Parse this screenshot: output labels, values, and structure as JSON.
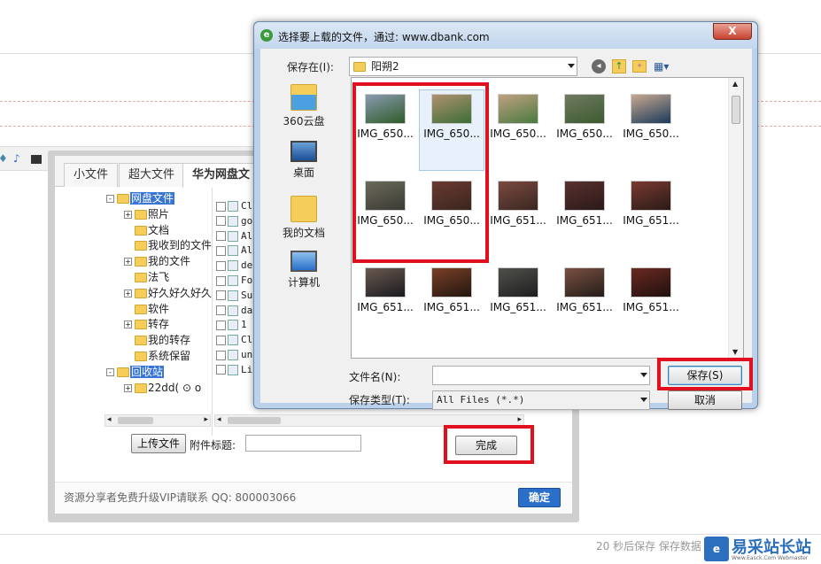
{
  "dialog": {
    "title": "选择要上载的文件，通过: www.dbank.com",
    "close_label": "X",
    "save_in_label": "保存在(I):",
    "save_in_value": "阳朔2",
    "places": [
      {
        "label": "360云盘",
        "icon": "cloud-folder-icon"
      },
      {
        "label": "桌面",
        "icon": "desktop-icon"
      },
      {
        "label": "我的文档",
        "icon": "documents-folder-icon"
      },
      {
        "label": "计算机",
        "icon": "computer-icon"
      }
    ],
    "files": [
      {
        "label": "IMG_650...",
        "c1": "#2e5b2a",
        "c2": "#8a9bb0"
      },
      {
        "label": "IMG_650...",
        "c1": "#3b6e35",
        "c2": "#b09070"
      },
      {
        "label": "IMG_650...",
        "c1": "#4a7a40",
        "c2": "#c0a080"
      },
      {
        "label": "IMG_650...",
        "c1": "#3c5a30",
        "c2": "#707a60"
      },
      {
        "label": "IMG_650...",
        "c1": "#1a3a5a",
        "c2": "#c8a890"
      },
      {
        "label": "IMG_650...",
        "c1": "#3a3a34",
        "c2": "#6a6a5a"
      },
      {
        "label": "IMG_650...",
        "c1": "#3a2620",
        "c2": "#6a3a30"
      },
      {
        "label": "IMG_651...",
        "c1": "#3a2622",
        "c2": "#7a4a40"
      },
      {
        "label": "IMG_651...",
        "c1": "#2a1a18",
        "c2": "#5a3030"
      },
      {
        "label": "IMG_651...",
        "c1": "#2a1a18",
        "c2": "#7a3a30"
      },
      {
        "label": "IMG_651...",
        "c1": "#1a1a20",
        "c2": "#6a5a50"
      },
      {
        "label": "IMG_651...",
        "c1": "#22160f",
        "c2": "#7a4028"
      },
      {
        "label": "IMG_651...",
        "c1": "#1e1e20",
        "c2": "#50504a"
      },
      {
        "label": "IMG_651...",
        "c1": "#231c1a",
        "c2": "#7a5040"
      },
      {
        "label": "IMG_651...",
        "c1": "#201010",
        "c2": "#6a2a20"
      }
    ],
    "filename_label": "文件名(N):",
    "filename_value": "",
    "filetype_label": "保存类型(T):",
    "filetype_value": "All Files (*.*)",
    "save_button": "保存(S)",
    "cancel_button": "取消"
  },
  "uploader": {
    "tabs": [
      "小文件",
      "超大文件",
      "华为网盘文"
    ],
    "tree": [
      {
        "label": "网盘文件",
        "level": 0,
        "pm": "-",
        "selected": true
      },
      {
        "label": "照片",
        "level": 1,
        "pm": "+"
      },
      {
        "label": "文档",
        "level": 1,
        "pm": ""
      },
      {
        "label": "我收到的文件",
        "level": 1,
        "pm": ""
      },
      {
        "label": "我的文件",
        "level": 1,
        "pm": "+"
      },
      {
        "label": "法飞",
        "level": 1,
        "pm": ""
      },
      {
        "label": "好久好久好久",
        "level": 1,
        "pm": "+"
      },
      {
        "label": "软件",
        "level": 1,
        "pm": ""
      },
      {
        "label": "转存",
        "level": 1,
        "pm": "+"
      },
      {
        "label": "我的转存",
        "level": 1,
        "pm": ""
      },
      {
        "label": "系统保留",
        "level": 1,
        "pm": ""
      },
      {
        "label": "回收站",
        "level": 0,
        "pm": "-",
        "selected": true
      },
      {
        "label": "22dd( ⊙ o",
        "level": 1,
        "pm": "+"
      }
    ],
    "files": [
      "Cl",
      "go",
      "Al",
      "Al",
      "de",
      "Fo",
      "Su",
      "da",
      "1 (",
      "Cl",
      "un",
      "Li"
    ],
    "upload_button": "上传文件",
    "attach_title_label": "附件标题:",
    "attach_title_value": "",
    "done_button": "完成",
    "footer_text": "资源分享者免费升级VIP请联系 QQ: 800003066",
    "confirm_button": "确定"
  },
  "page": {
    "autosave_text": "20 秒后保存 保存数据"
  },
  "watermark": {
    "text": "易采站长站",
    "sub": "Www.Easck.Com Webmaster"
  },
  "colors": {
    "highlight": "#e0101e",
    "confirm": "#2a6fc9",
    "selection": "#3875d7"
  }
}
